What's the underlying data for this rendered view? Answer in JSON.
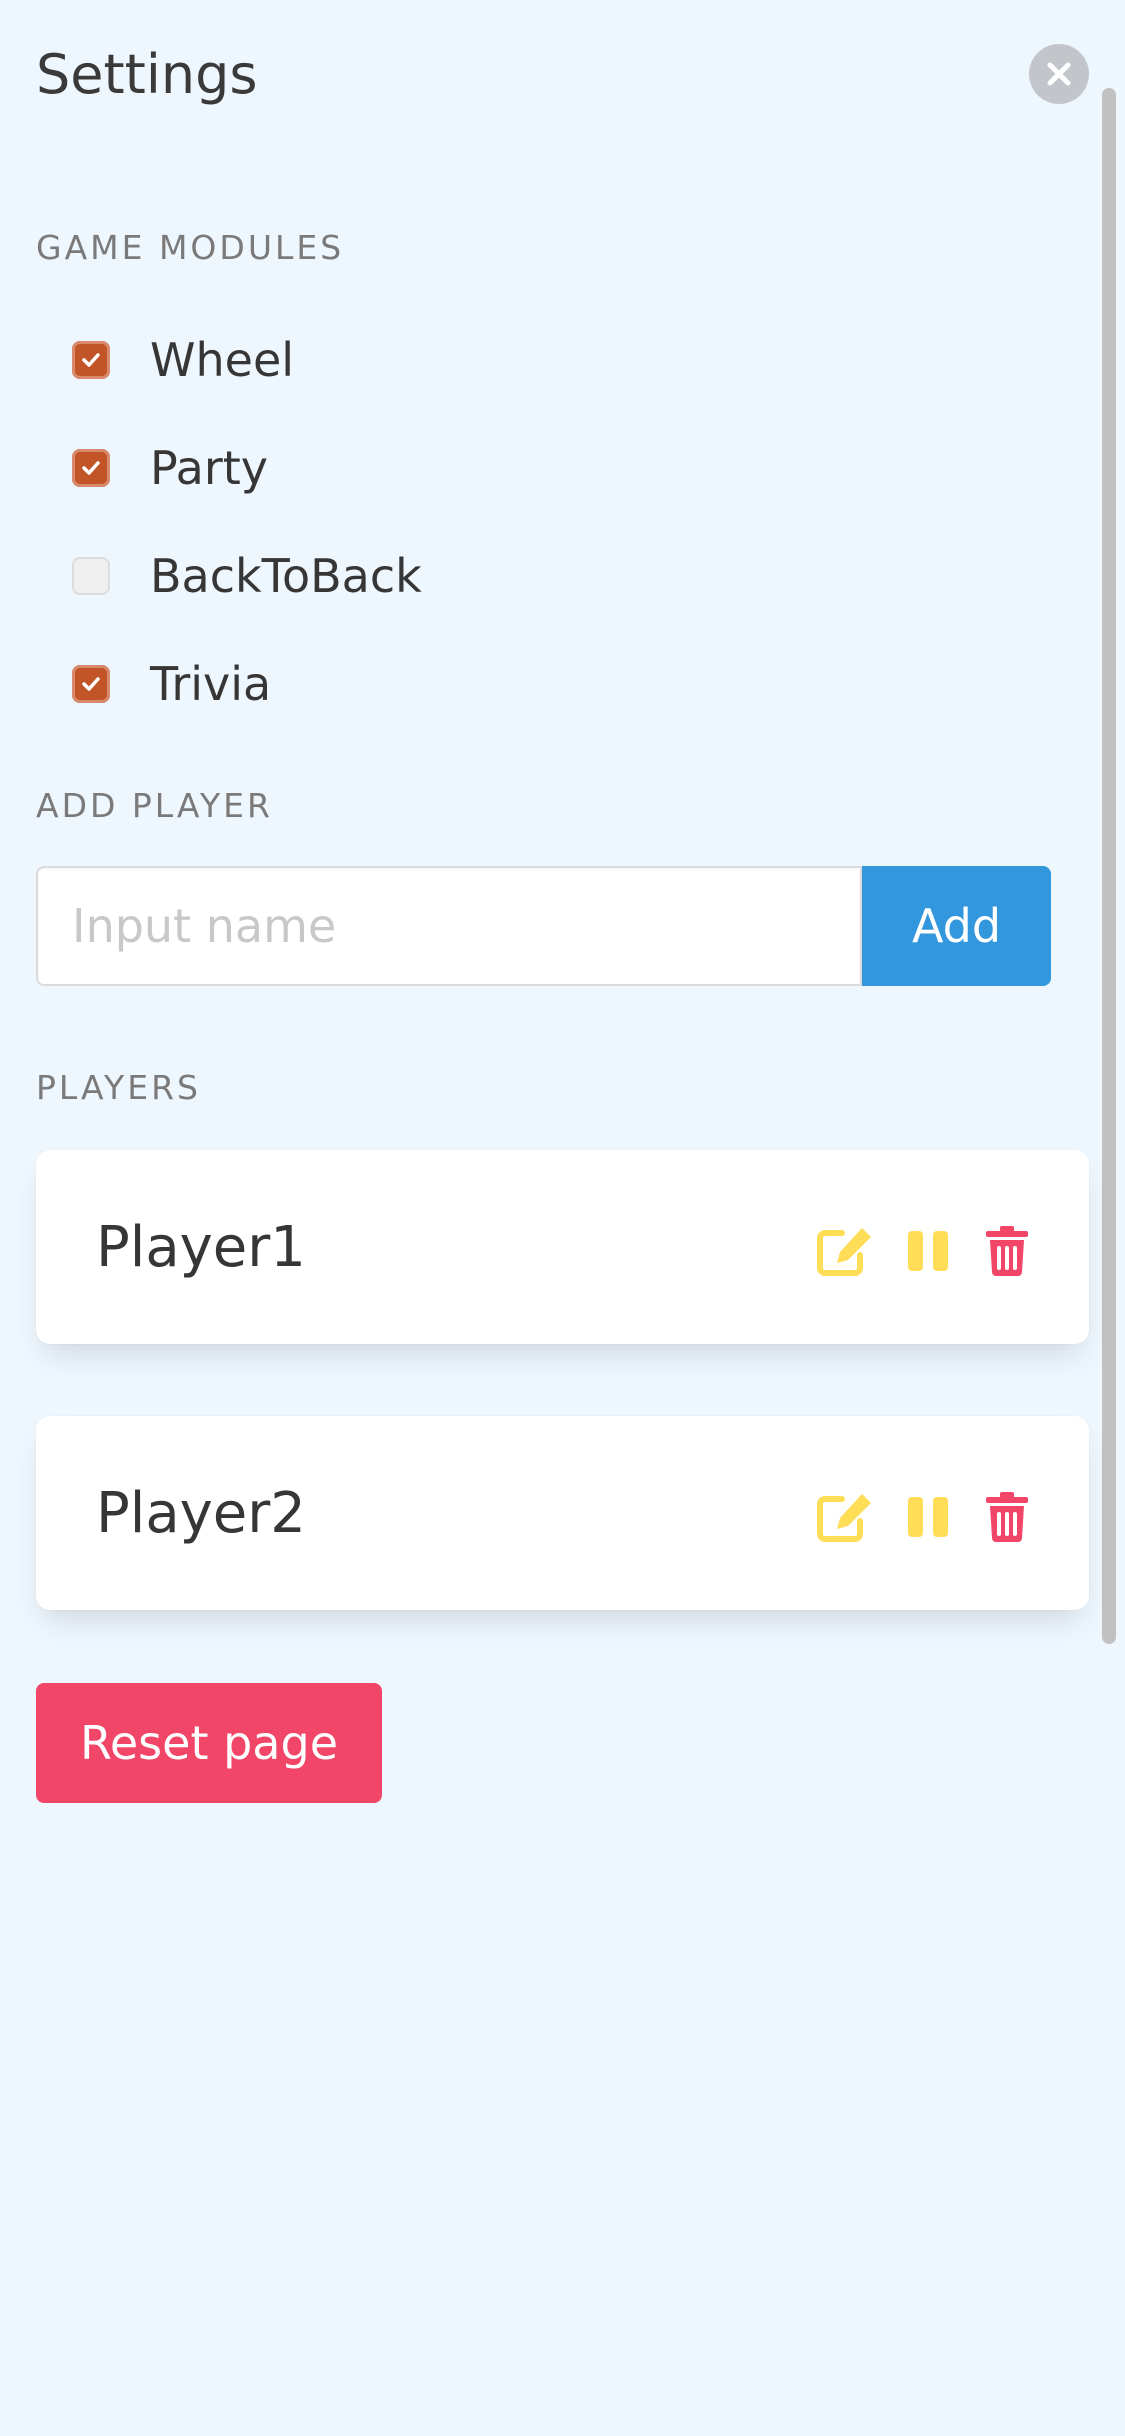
{
  "header": {
    "title": "Settings",
    "close_icon": "close-icon"
  },
  "modules": {
    "label": "GAME MODULES",
    "items": [
      {
        "label": "Wheel",
        "checked": true
      },
      {
        "label": "Party",
        "checked": true
      },
      {
        "label": "BackToBack",
        "checked": false
      },
      {
        "label": "Trivia",
        "checked": true
      }
    ]
  },
  "add_player": {
    "label": "ADD PLAYER",
    "placeholder": "Input name",
    "value": "",
    "button_label": "Add"
  },
  "players": {
    "label": "PLAYERS",
    "items": [
      {
        "name": "Player1"
      },
      {
        "name": "Player2"
      }
    ],
    "actions": {
      "edit_icon": "edit-icon",
      "pause_icon": "pause-icon",
      "delete_icon": "trash-icon"
    }
  },
  "reset_button_label": "Reset page",
  "colors": {
    "background": "#eef6fe",
    "checkbox_checked": "#c25527",
    "primary": "#3397dd",
    "danger": "#f14668",
    "warning": "#ffdd57"
  }
}
